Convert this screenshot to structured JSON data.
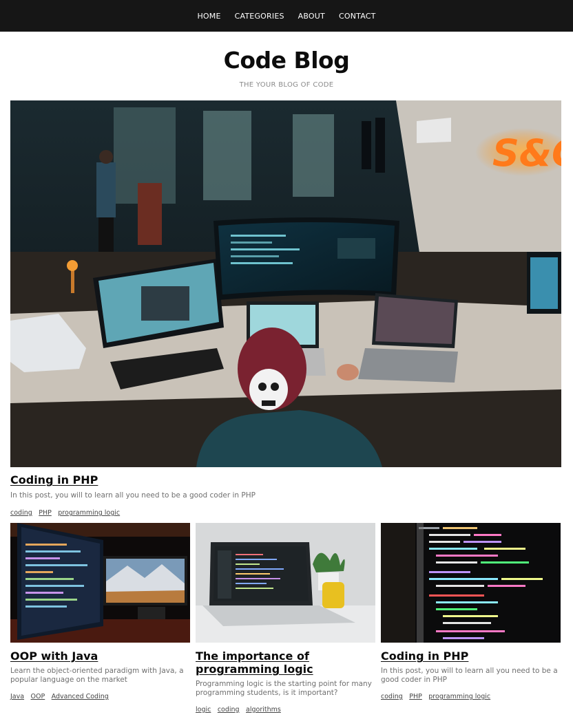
{
  "nav": {
    "items": [
      "HOME",
      "CATEGORIES",
      "ABOUT",
      "CONTACT"
    ]
  },
  "header": {
    "title": "Code Blog",
    "tagline": "THE YOUR BLOG OF CODE"
  },
  "featured": {
    "title": "Coding in PHP",
    "description": "In this post, you will to learn all you need to be a good coder in PHP",
    "tags": [
      "coding",
      "PHP",
      "programming logic"
    ],
    "image": "photo of a developer in a dark office with multiple monitors"
  },
  "posts": [
    {
      "title": "OOP with Java",
      "description": "Learn the object-oriented paradigm with Java, a popular language on the market",
      "tags": [
        "Java",
        "OOP",
        "Advanced Coding"
      ],
      "image": "dual monitors showing code and a mountain wallpaper"
    },
    {
      "title": "The importance of programming logic",
      "description": "Programming logic is the starting point for many programming students, is it important?",
      "tags": [
        "logic",
        "coding",
        "algorithms"
      ],
      "image": "laptop on a white desk with a plant and yellow mug"
    },
    {
      "title": "Coding in PHP",
      "description": "In this post, you will to learn all you need to be a good coder in PHP",
      "tags": [
        "coding",
        "PHP",
        "programming logic"
      ],
      "image": "close-up of colorful code on a dark screen"
    }
  ],
  "colors": {
    "navbar": "#161616",
    "title": "#0c0c0c",
    "muted": "#6f6f6f"
  }
}
